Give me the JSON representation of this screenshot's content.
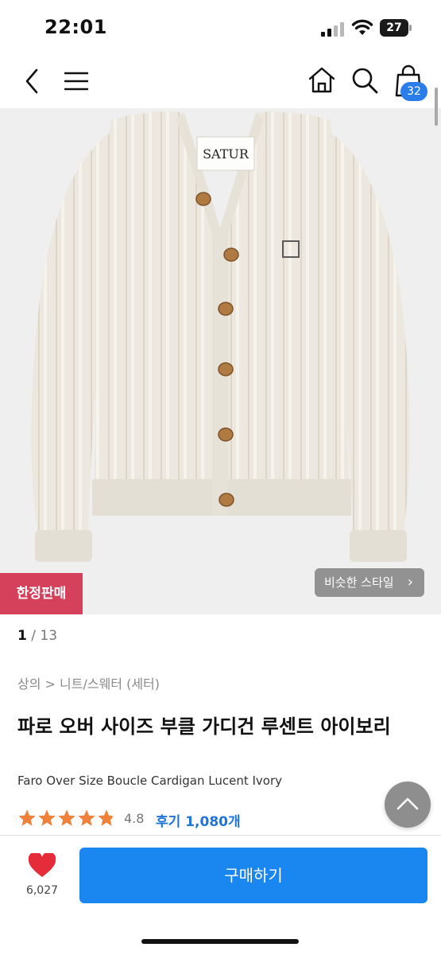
{
  "status_bar": {
    "time": "22:01",
    "battery": "27"
  },
  "nav": {
    "cart_count": "32"
  },
  "product_image": {
    "brand_label": "SATUR",
    "badge": "한정판매",
    "similar_style_label": "비슷한 스타일"
  },
  "pager": {
    "current": "1",
    "separator": " / ",
    "total": "13"
  },
  "breadcrumb": "상의 > 니트/스웨터 (세터)",
  "product": {
    "title_ko": "파로 오버 사이즈 부클 가디건 루센트 아이보리",
    "title_en": "Faro Over Size Boucle Cardigan Lucent Ivory",
    "rating": "4.8",
    "stars": 4.8,
    "review_label": "후기 1,080개"
  },
  "bottom_bar": {
    "like_count": "6,027",
    "buy_label": "구매하기"
  },
  "colors": {
    "accent": "#1a86f0",
    "badge": "#d5405b",
    "star": "#f0813a",
    "heart": "#e52c3a"
  }
}
